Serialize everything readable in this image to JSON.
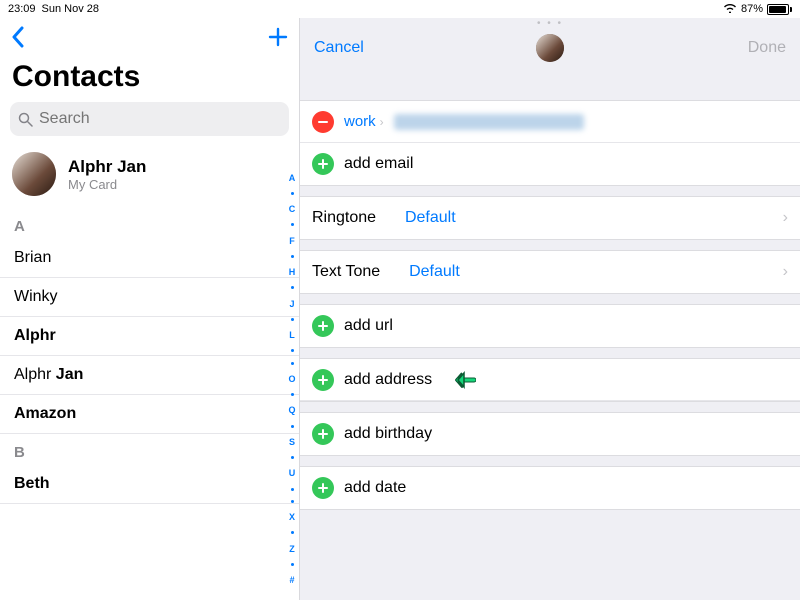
{
  "status": {
    "time": "23:09",
    "date": "Sun Nov 28",
    "battery_pct": "87%"
  },
  "left": {
    "title": "Contacts",
    "search_placeholder": "Search",
    "me": {
      "name": "Alphr Jan",
      "sub": "My Card"
    },
    "sections": [
      {
        "letter": "A",
        "rows": [
          {
            "first": "Brian",
            "last": ""
          },
          {
            "first": "Winky",
            "last": ""
          },
          {
            "first": "",
            "last": "Alphr",
            "boldLast": true
          },
          {
            "first": "Alphr",
            "last": "Jan"
          },
          {
            "first": "",
            "last": "Amazon",
            "boldLast": true
          }
        ]
      },
      {
        "letter": "B",
        "rows": [
          {
            "first": "",
            "last": "Beth",
            "boldLast": true
          }
        ]
      }
    ],
    "index": [
      "A",
      "•",
      "C",
      "•",
      "F",
      "•",
      "H",
      "•",
      "J",
      "•",
      "L",
      "•",
      "•",
      "O",
      "•",
      "Q",
      "•",
      "S",
      "•",
      "U",
      "•",
      "•",
      "X",
      "•",
      "Z",
      "•",
      "#"
    ]
  },
  "right": {
    "cancel": "Cancel",
    "done": "Done",
    "email": {
      "type_label": "work",
      "add_label": "add email"
    },
    "ringtone": {
      "label": "Ringtone",
      "value": "Default"
    },
    "texttone": {
      "label": "Text Tone",
      "value": "Default"
    },
    "add_url": "add url",
    "add_address": "add address",
    "add_birthday": "add birthday",
    "add_date": "add date"
  }
}
